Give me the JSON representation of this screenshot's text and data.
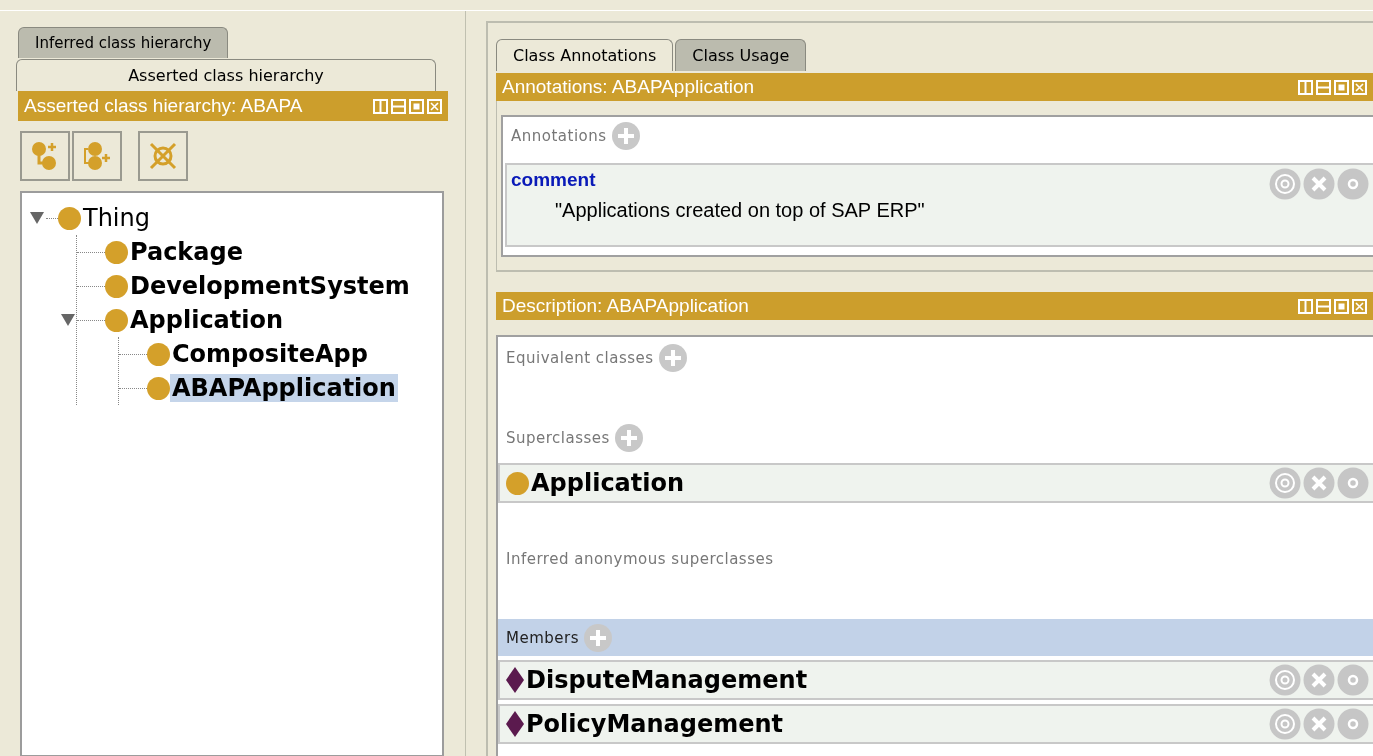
{
  "hierarchy_panel": {
    "tabs": [
      {
        "label": "Inferred class hierarchy",
        "selected": false
      },
      {
        "label": "Asserted class hierarchy",
        "selected": true
      }
    ],
    "header": "Asserted class hierarchy: ABAPA",
    "toolbar": [
      {
        "kind": "add-subclass"
      },
      {
        "kind": "add-sibling"
      },
      {
        "kind": "delete"
      }
    ],
    "tree": [
      {
        "label": "Thing",
        "bold": false,
        "selected": false,
        "expanded": true,
        "children": [
          {
            "label": "Package",
            "bold": true,
            "selected": false
          },
          {
            "label": "DevelopmentSystem",
            "bold": true,
            "selected": false
          },
          {
            "label": "Application",
            "bold": true,
            "selected": false,
            "expanded": true,
            "children": [
              {
                "label": "CompositeApp",
                "bold": true,
                "selected": false
              },
              {
                "label": "ABAPApplication",
                "bold": true,
                "selected": true
              }
            ]
          }
        ]
      }
    ]
  },
  "editor": {
    "tabs": [
      {
        "label": "Class Annotations",
        "selected": true
      },
      {
        "label": "Class Usage",
        "selected": false
      }
    ],
    "annotations_view": {
      "header": "Annotations: ABAPApplication",
      "section": "Annotations",
      "items": [
        {
          "property": "comment",
          "value": "\"Applications created on top of SAP ERP\""
        }
      ]
    },
    "description_view": {
      "header": "Description: ABAPApplication",
      "sections": [
        {
          "title": "Equivalent classes",
          "addable": true,
          "highlighted": false
        },
        {
          "title": "Superclasses",
          "addable": true,
          "highlighted": false,
          "items": [
            {
              "label": "Application",
              "kind": "class"
            }
          ]
        },
        {
          "title": "Inferred anonymous superclasses",
          "addable": false,
          "highlighted": false
        },
        {
          "title": "Members",
          "addable": true,
          "highlighted": true,
          "items": [
            {
              "label": "DisputeManagement",
              "kind": "individual"
            },
            {
              "label": "PolicyManagement",
              "kind": "individual"
            }
          ]
        }
      ]
    }
  }
}
